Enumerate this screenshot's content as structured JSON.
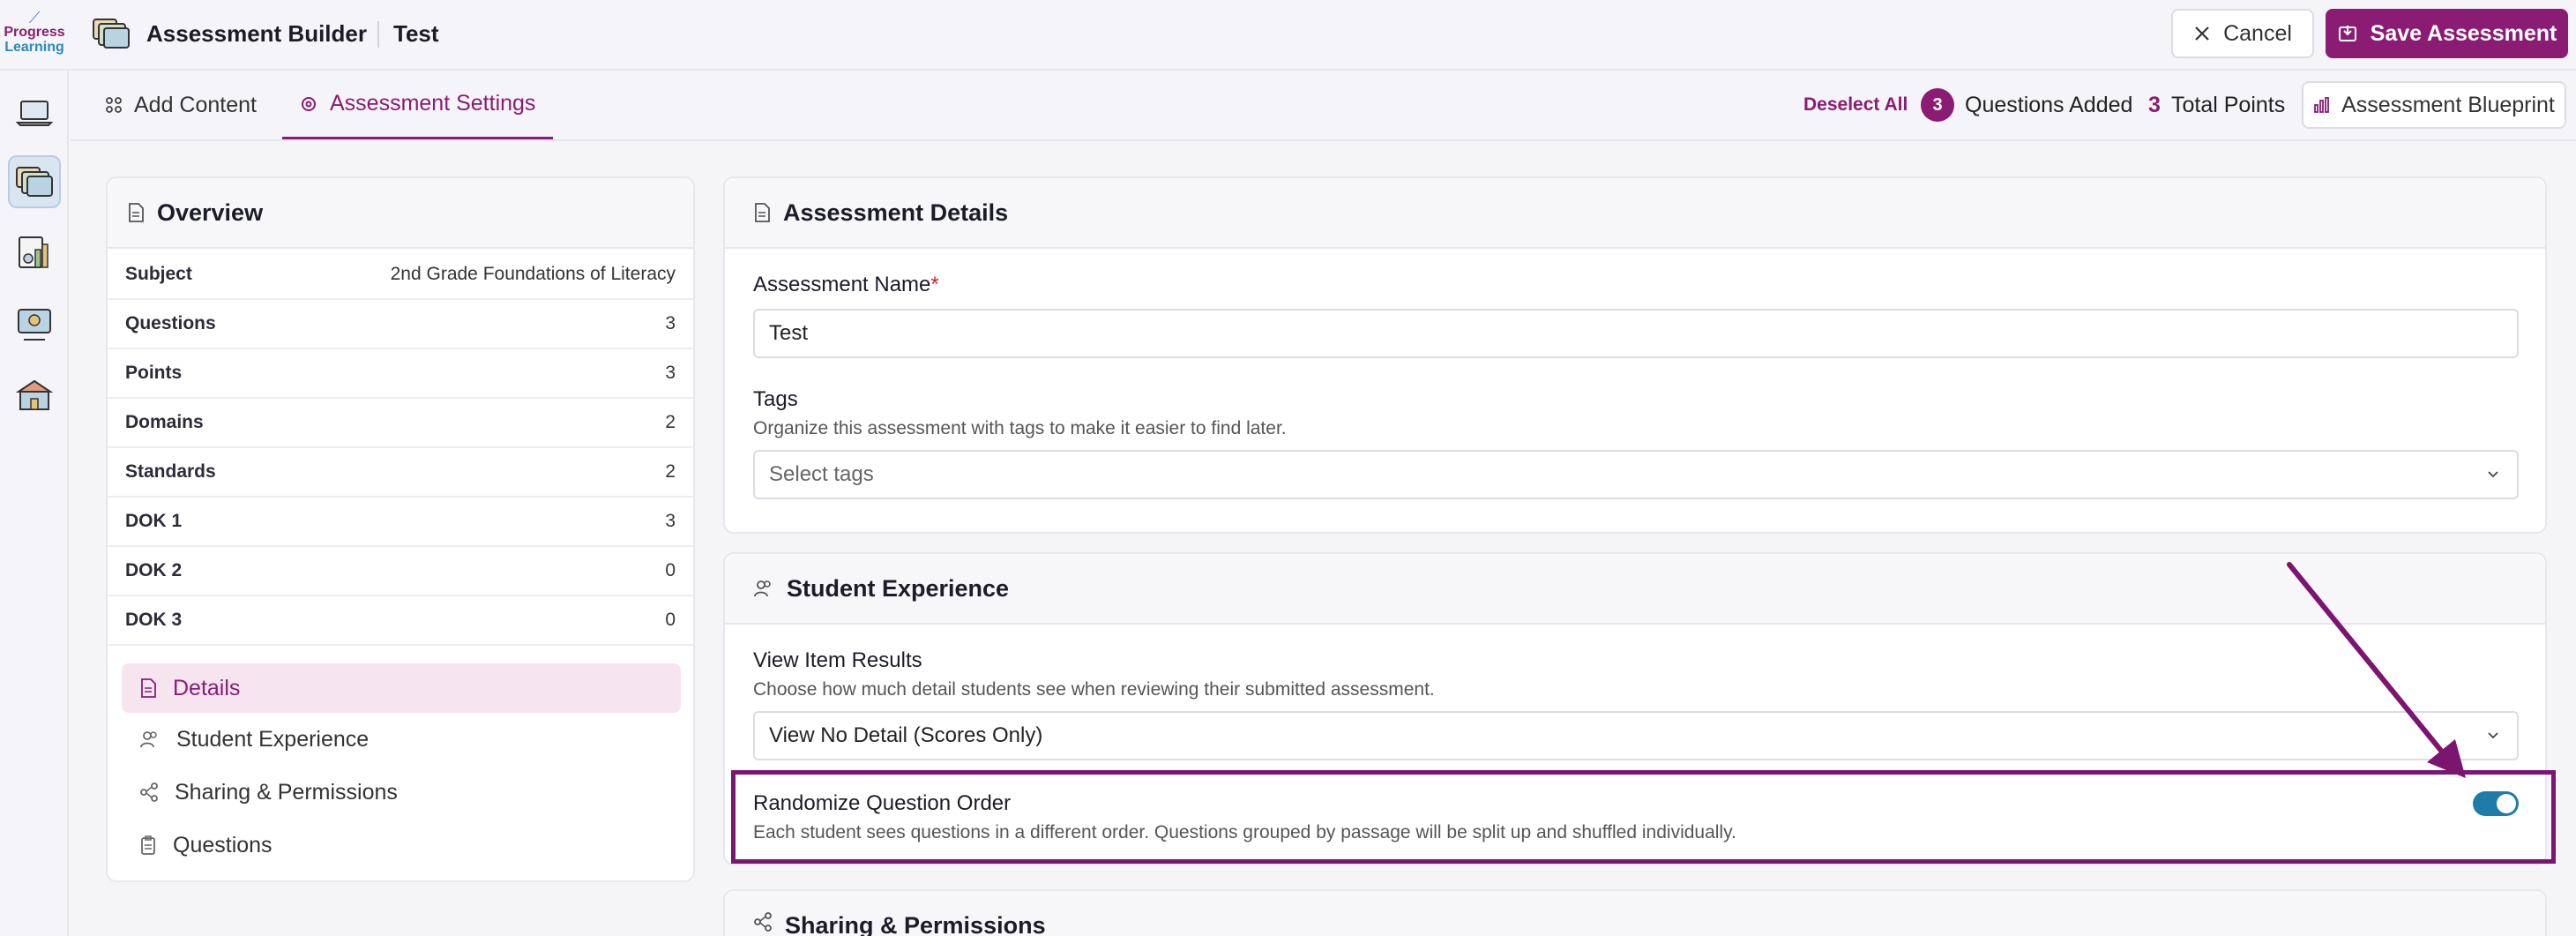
{
  "colors": {
    "brand": "#8b1c74",
    "toggle_on": "#1f7ca8",
    "annotation": "#7b1570"
  },
  "logo": {
    "line1": "Progress",
    "line2": "Learning"
  },
  "header": {
    "app_title": "Assessment Builder",
    "assessment_name": "Test",
    "cancel_label": "Cancel",
    "save_label": "Save Assessment"
  },
  "rail": {
    "items": [
      "laptop-icon",
      "assessment-builder-icon",
      "reports-icon",
      "lesson-icon",
      "school-icon"
    ]
  },
  "tabs": [
    {
      "label": "Add Content",
      "icon": "grid-icon",
      "active": false
    },
    {
      "label": "Assessment Settings",
      "icon": "settings-icon",
      "active": true
    }
  ],
  "summary": {
    "deselect_label": "Deselect All",
    "questions_count": "3",
    "questions_label": "Questions Added",
    "points_count": "3",
    "points_label": "Total Points",
    "blueprint_label": "Assessment Blueprint"
  },
  "overview": {
    "title": "Overview",
    "rows": [
      {
        "key": "Subject",
        "value": "2nd Grade Foundations of Literacy"
      },
      {
        "key": "Questions",
        "value": "3"
      },
      {
        "key": "Points",
        "value": "3"
      },
      {
        "key": "Domains",
        "value": "2"
      },
      {
        "key": "Standards",
        "value": "2"
      },
      {
        "key": "DOK 1",
        "value": "3"
      },
      {
        "key": "DOK 2",
        "value": "0"
      },
      {
        "key": "DOK 3",
        "value": "0"
      }
    ],
    "nav": [
      {
        "label": "Details",
        "active": true
      },
      {
        "label": "Student Experience",
        "active": false
      },
      {
        "label": "Sharing & Permissions",
        "active": false
      },
      {
        "label": "Questions",
        "active": false
      }
    ]
  },
  "details": {
    "title": "Assessment Details",
    "name_label": "Assessment Name",
    "required_mark": "*",
    "name_value": "Test",
    "tags_label": "Tags",
    "tags_hint": "Organize this assessment with tags to make it easier to find later.",
    "tags_placeholder": "Select tags"
  },
  "student_experience": {
    "title": "Student Experience",
    "view_results_label": "View Item Results",
    "view_results_hint": "Choose how much detail students see when reviewing their submitted assessment.",
    "view_results_value": "View No Detail (Scores Only)",
    "randomize_label": "Randomize Question Order",
    "randomize_hint": "Each student sees questions in a different order. Questions grouped by passage will be split up and shuffled individually.",
    "randomize_on": true
  },
  "sharing": {
    "title": "Sharing & Permissions"
  }
}
